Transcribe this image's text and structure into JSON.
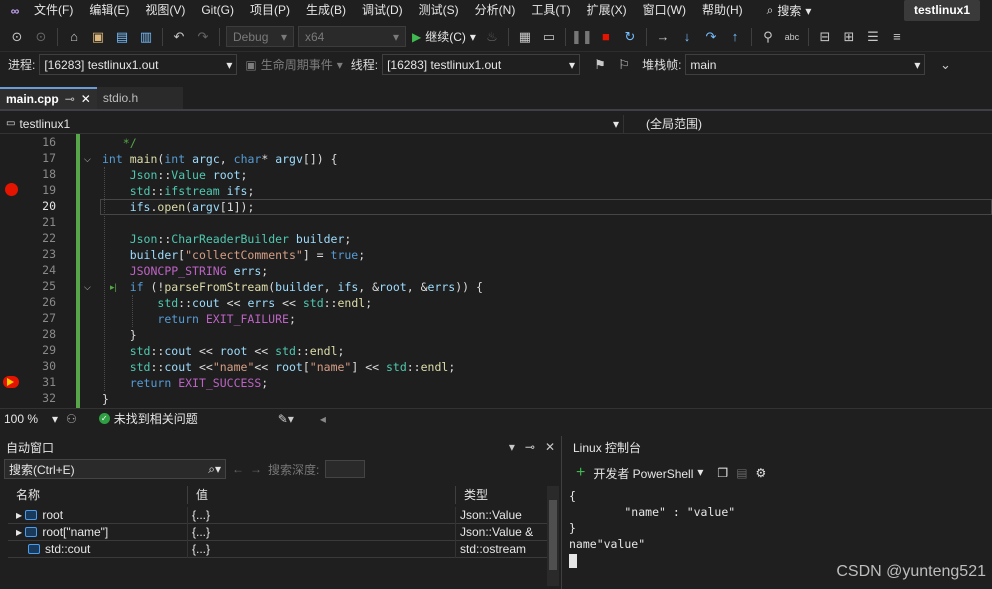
{
  "menu": {
    "items": [
      "文件(F)",
      "编辑(E)",
      "视图(V)",
      "Git(G)",
      "项目(P)",
      "生成(B)",
      "调试(D)",
      "测试(S)",
      "分析(N)",
      "工具(T)",
      "扩展(X)",
      "窗口(W)",
      "帮助(H)"
    ],
    "search_label": "搜索",
    "project_title": "testlinux1"
  },
  "toolbar": {
    "config": "Debug",
    "platform": "x64",
    "continue_label": "继续(C)"
  },
  "debug_location": {
    "process_label": "进程:",
    "process_value": "[16283] testlinux1.out",
    "lifecycle_label": "生命周期事件",
    "thread_label": "线程:",
    "thread_value": "[16283] testlinux1.out",
    "stack_label": "堆栈帧:",
    "stack_value": "main"
  },
  "tabs": [
    {
      "label": "main.cpp",
      "active": true
    },
    {
      "label": "stdio.h",
      "active": false
    }
  ],
  "navbar": {
    "project": "testlinux1",
    "scope": "(全局范围)"
  },
  "editor": {
    "line_numbers": [
      "16",
      "17",
      "18",
      "19",
      "20",
      "21",
      "22",
      "23",
      "24",
      "25",
      "26",
      "27",
      "28",
      "29",
      "30",
      "31",
      "32"
    ],
    "current_line": "20",
    "breakpoint_line": "19",
    "execution_line": "31"
  },
  "status": {
    "zoom": "100 %",
    "issues": "未找到相关问题"
  },
  "autos": {
    "title": "自动窗口",
    "search_placeholder": "搜索(Ctrl+E)",
    "depth_label": "搜索深度:",
    "columns": [
      "名称",
      "值",
      "类型"
    ],
    "rows": [
      {
        "name": "root",
        "value": "{...}",
        "type": "Json::Value"
      },
      {
        "name": "root[\"name\"]",
        "value": "{...}",
        "type": "Json::Value &"
      },
      {
        "name": "std::cout",
        "value": "{...}",
        "type": "std::ostream"
      }
    ]
  },
  "console": {
    "title": "Linux 控制台",
    "shell_label": "开发者 PowerShell",
    "output_lines": [
      "{",
      "        \"name\" : \"value\"",
      "}",
      "name\"value\""
    ]
  },
  "watermark": "CSDN @yunteng521"
}
